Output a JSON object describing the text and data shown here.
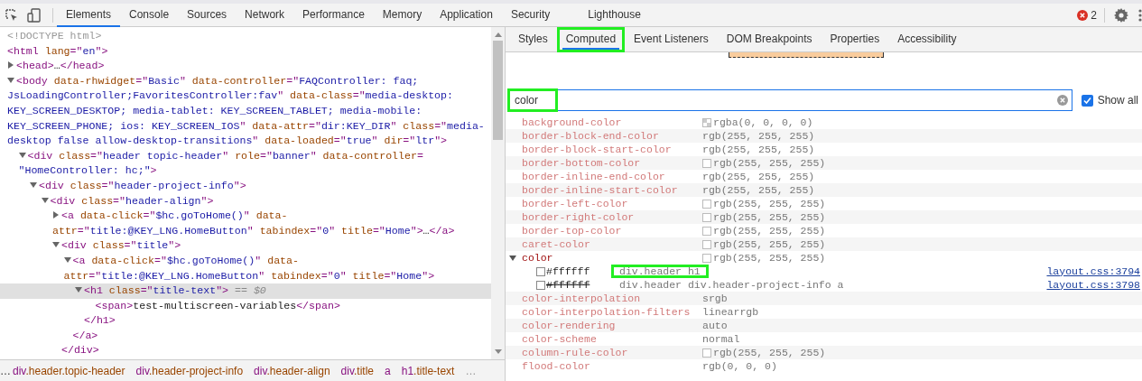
{
  "main_tabs": [
    {
      "label": "Elements",
      "selected": true
    },
    {
      "label": "Console",
      "selected": false
    },
    {
      "label": "Sources",
      "selected": false
    },
    {
      "label": "Network",
      "selected": false
    },
    {
      "label": "Performance",
      "selected": false
    },
    {
      "label": "Memory",
      "selected": false
    },
    {
      "label": "Application",
      "selected": false
    },
    {
      "label": "Security",
      "selected": false
    },
    {
      "label": "Lighthouse",
      "selected": false
    }
  ],
  "error_count": "2",
  "dom_tree": [
    {
      "selected": false,
      "tokens": [
        {
          "kind": "doc",
          "s": "<!DOCTYPE html>"
        }
      ]
    },
    {
      "selected": false,
      "tokens": [
        {
          "kind": "tag",
          "s": "<html "
        },
        {
          "kind": "attr",
          "s": "lang"
        },
        {
          "kind": "tag",
          "s": "=\""
        },
        {
          "kind": "val",
          "s": "en"
        },
        {
          "kind": "tag",
          "s": "\">"
        }
      ],
      "children": [
        {
          "expanded": false,
          "selected": false,
          "tokens": [
            {
              "kind": "tag",
              "s": "<head>"
            },
            {
              "kind": "text",
              "s": "…"
            },
            {
              "kind": "tag",
              "s": "</head>"
            }
          ]
        },
        {
          "expanded": true,
          "selected": false,
          "tokens": [
            {
              "kind": "tag",
              "s": "<body "
            },
            {
              "kind": "attr",
              "s": "data-rhwidget"
            },
            {
              "kind": "tag",
              "s": "=\""
            },
            {
              "kind": "val",
              "s": "Basic"
            },
            {
              "kind": "tag",
              "s": "\" "
            },
            {
              "kind": "attr",
              "s": "data-controller"
            },
            {
              "kind": "tag",
              "s": "=\""
            },
            {
              "kind": "val",
              "s": "FAQController: faq; JsLoadingController;FavoritesController:fav"
            },
            {
              "kind": "tag",
              "s": "\" "
            },
            {
              "kind": "attr",
              "s": "data-class"
            },
            {
              "kind": "tag",
              "s": "=\""
            },
            {
              "kind": "val",
              "s": "media-desktop: KEY_SCREEN_DESKTOP; media-tablet: KEY_SCREEN_TABLET; media-mobile: KEY_SCREEN_PHONE; ios: KEY_SCREEN_IOS"
            },
            {
              "kind": "tag",
              "s": "\" "
            },
            {
              "kind": "attr",
              "s": "data-attr"
            },
            {
              "kind": "tag",
              "s": "=\""
            },
            {
              "kind": "val",
              "s": "dir:KEY_DIR"
            },
            {
              "kind": "tag",
              "s": "\" "
            },
            {
              "kind": "attr",
              "s": "class"
            },
            {
              "kind": "tag",
              "s": "=\""
            },
            {
              "kind": "val",
              "s": "media-desktop false allow-desktop-transitions"
            },
            {
              "kind": "tag",
              "s": "\" "
            },
            {
              "kind": "attr",
              "s": "data-loaded"
            },
            {
              "kind": "tag",
              "s": "=\""
            },
            {
              "kind": "val",
              "s": "true"
            },
            {
              "kind": "tag",
              "s": "\" "
            },
            {
              "kind": "attr",
              "s": "dir"
            },
            {
              "kind": "tag",
              "s": "=\""
            },
            {
              "kind": "val",
              "s": "ltr"
            },
            {
              "kind": "tag",
              "s": "\">"
            }
          ],
          "children": [
            {
              "expanded": true,
              "selected": false,
              "tokens": [
                {
                  "kind": "tag",
                  "s": "<div "
                },
                {
                  "kind": "attr",
                  "s": "class"
                },
                {
                  "kind": "tag",
                  "s": "=\""
                },
                {
                  "kind": "val",
                  "s": "header topic-header"
                },
                {
                  "kind": "tag",
                  "s": "\" "
                },
                {
                  "kind": "attr",
                  "s": "role"
                },
                {
                  "kind": "tag",
                  "s": "=\""
                },
                {
                  "kind": "val",
                  "s": "banner"
                },
                {
                  "kind": "tag",
                  "s": "\" "
                },
                {
                  "kind": "attr",
                  "s": "data-controller"
                },
                {
                  "kind": "tag",
                  "s": "= "
                },
                {
                  "kind": "val",
                  "s": "\"HomeController: hc;\""
                },
                {
                  "kind": "tag",
                  "s": ">"
                }
              ],
              "children": [
                {
                  "expanded": true,
                  "selected": false,
                  "tokens": [
                    {
                      "kind": "tag",
                      "s": "<div "
                    },
                    {
                      "kind": "attr",
                      "s": "class"
                    },
                    {
                      "kind": "tag",
                      "s": "=\""
                    },
                    {
                      "kind": "val",
                      "s": "header-project-info"
                    },
                    {
                      "kind": "tag",
                      "s": "\">"
                    }
                  ],
                  "children": [
                    {
                      "expanded": true,
                      "selected": false,
                      "tokens": [
                        {
                          "kind": "tag",
                          "s": "<div "
                        },
                        {
                          "kind": "attr",
                          "s": "class"
                        },
                        {
                          "kind": "tag",
                          "s": "=\""
                        },
                        {
                          "kind": "val",
                          "s": "header-align"
                        },
                        {
                          "kind": "tag",
                          "s": "\">"
                        }
                      ],
                      "children": [
                        {
                          "expanded": false,
                          "selected": false,
                          "tokens": [
                            {
                              "kind": "tag",
                              "s": "<a "
                            },
                            {
                              "kind": "attr",
                              "s": "data-click"
                            },
                            {
                              "kind": "tag",
                              "s": "=\""
                            },
                            {
                              "kind": "val",
                              "s": "$hc.goToHome()"
                            },
                            {
                              "kind": "tag",
                              "s": "\" "
                            },
                            {
                              "kind": "attr",
                              "s": "data-attr"
                            },
                            {
                              "kind": "tag",
                              "s": "=\""
                            },
                            {
                              "kind": "val",
                              "s": "title:@KEY_LNG.HomeButton"
                            },
                            {
                              "kind": "tag",
                              "s": "\" "
                            },
                            {
                              "kind": "attr",
                              "s": "tabindex"
                            },
                            {
                              "kind": "tag",
                              "s": "=\""
                            },
                            {
                              "kind": "val",
                              "s": "0"
                            },
                            {
                              "kind": "tag",
                              "s": "\" "
                            },
                            {
                              "kind": "attr",
                              "s": "title"
                            },
                            {
                              "kind": "tag",
                              "s": "=\""
                            },
                            {
                              "kind": "val",
                              "s": "Home"
                            },
                            {
                              "kind": "tag",
                              "s": "\">"
                            },
                            {
                              "kind": "text",
                              "s": "…"
                            },
                            {
                              "kind": "tag",
                              "s": "</a>"
                            }
                          ]
                        },
                        {
                          "expanded": true,
                          "selected": false,
                          "tokens": [
                            {
                              "kind": "tag",
                              "s": "<div "
                            },
                            {
                              "kind": "attr",
                              "s": "class"
                            },
                            {
                              "kind": "tag",
                              "s": "=\""
                            },
                            {
                              "kind": "val",
                              "s": "title"
                            },
                            {
                              "kind": "tag",
                              "s": "\">"
                            }
                          ],
                          "children": [
                            {
                              "expanded": true,
                              "selected": false,
                              "tokens": [
                                {
                                  "kind": "tag",
                                  "s": "<a "
                                },
                                {
                                  "kind": "attr",
                                  "s": "data-click"
                                },
                                {
                                  "kind": "tag",
                                  "s": "=\""
                                },
                                {
                                  "kind": "val",
                                  "s": "$hc.goToHome()"
                                },
                                {
                                  "kind": "tag",
                                  "s": "\" "
                                },
                                {
                                  "kind": "attr",
                                  "s": "data-attr"
                                },
                                {
                                  "kind": "tag",
                                  "s": "=\""
                                },
                                {
                                  "kind": "val",
                                  "s": "title:@KEY_LNG.HomeButton"
                                },
                                {
                                  "kind": "tag",
                                  "s": "\" "
                                },
                                {
                                  "kind": "attr",
                                  "s": "tabindex"
                                },
                                {
                                  "kind": "tag",
                                  "s": "=\""
                                },
                                {
                                  "kind": "val",
                                  "s": "0"
                                },
                                {
                                  "kind": "tag",
                                  "s": "\" "
                                },
                                {
                                  "kind": "attr",
                                  "s": "title"
                                },
                                {
                                  "kind": "tag",
                                  "s": "=\""
                                },
                                {
                                  "kind": "val",
                                  "s": "Home"
                                },
                                {
                                  "kind": "tag",
                                  "s": "\">"
                                }
                              ],
                              "children": [
                                {
                                  "expanded": true,
                                  "selected": true,
                                  "tokens": [
                                    {
                                      "kind": "tag",
                                      "s": "<h1 "
                                    },
                                    {
                                      "kind": "attr",
                                      "s": "class"
                                    },
                                    {
                                      "kind": "tag",
                                      "s": "=\""
                                    },
                                    {
                                      "kind": "val",
                                      "s": "title-text"
                                    },
                                    {
                                      "kind": "tag",
                                      "s": "\">"
                                    },
                                    {
                                      "kind": "dim",
                                      "s": " == $0"
                                    }
                                  ],
                                  "children": [
                                    {
                                      "selected": false,
                                      "tokens": [
                                        {
                                          "kind": "tag",
                                          "s": "<span>"
                                        },
                                        {
                                          "kind": "text",
                                          "s": "test-multiscreen-variables"
                                        },
                                        {
                                          "kind": "tag",
                                          "s": "</span>"
                                        }
                                      ]
                                    }
                                  ],
                                  "closing": "</h1>"
                                }
                              ],
                              "closing": "</a>"
                            }
                          ],
                          "closing": "</div>"
                        }
                      ]
                    }
                  ]
                }
              ]
            }
          ]
        }
      ]
    }
  ],
  "breadcrumbs": {
    "lead": "…",
    "items": [
      {
        "tag": "div",
        "cls": ".header.topic-header"
      },
      {
        "tag": "div",
        "cls": ".header-project-info"
      },
      {
        "tag": "div",
        "cls": ".header-align"
      },
      {
        "tag": "div",
        "cls": ".title"
      },
      {
        "tag": "a"
      },
      {
        "tag": "h1",
        "cls": ".title-text"
      }
    ],
    "trail": "…"
  },
  "side_tabs": [
    {
      "label": "Styles",
      "selected": false,
      "highlighted": false
    },
    {
      "label": "Computed",
      "selected": true,
      "highlighted": true
    },
    {
      "label": "Event Listeners",
      "selected": false,
      "highlighted": false
    },
    {
      "label": "DOM Breakpoints",
      "selected": false,
      "highlighted": false
    },
    {
      "label": "Properties",
      "selected": false,
      "highlighted": false
    },
    {
      "label": "Accessibility",
      "selected": false,
      "highlighted": false
    }
  ],
  "filter": {
    "value": "color",
    "highlighted": true
  },
  "show_all": {
    "label": "Show all",
    "checked": true
  },
  "properties": [
    {
      "kind": "checker",
      "name": "background-color",
      "value": "rgba(0, 0, 0, 0)"
    },
    {
      "kind": "plain",
      "name": "border-block-end-color",
      "value": "rgb(255, 255, 255)"
    },
    {
      "kind": "plain",
      "name": "border-block-start-color",
      "value": "rgb(255, 255, 255)"
    },
    {
      "kind": "swatch",
      "name": "border-bottom-color",
      "value": "rgb(255, 255, 255)"
    },
    {
      "kind": "plain",
      "name": "border-inline-end-color",
      "value": "rgb(255, 255, 255)"
    },
    {
      "kind": "plain",
      "name": "border-inline-start-color",
      "value": "rgb(255, 255, 255)"
    },
    {
      "kind": "swatch",
      "name": "border-left-color",
      "value": "rgb(255, 255, 255)"
    },
    {
      "kind": "swatch",
      "name": "border-right-color",
      "value": "rgb(255, 255, 255)"
    },
    {
      "kind": "swatch",
      "name": "border-top-color",
      "value": "rgb(255, 255, 255)"
    },
    {
      "kind": "swatch",
      "name": "caret-color",
      "value": "rgb(255, 255, 255)"
    },
    {
      "kind": "swatch",
      "name": "color",
      "value": "rgb(255, 255, 255)",
      "expanded": true,
      "traces": [
        {
          "value": "#ffffff",
          "selector": "div.header h1",
          "source": "layout.css:3794",
          "overridden": false,
          "highlighted": true
        },
        {
          "value": "#ffffff",
          "selector": "div.header div.header-project-info a",
          "source": "layout.css:3798",
          "overridden": true,
          "highlighted": false
        }
      ]
    },
    {
      "kind": "plain",
      "name": "color-interpolation",
      "value": "srgb"
    },
    {
      "kind": "plain",
      "name": "color-interpolation-filters",
      "value": "linearrgb"
    },
    {
      "kind": "plain",
      "name": "color-rendering",
      "value": "auto"
    },
    {
      "kind": "plain",
      "name": "color-scheme",
      "value": "normal"
    },
    {
      "kind": "swatch",
      "name": "column-rule-color",
      "value": "rgb(255, 255, 255)"
    },
    {
      "kind": "plain",
      "name": "flood-color",
      "value": "rgb(0, 0, 0)"
    }
  ]
}
